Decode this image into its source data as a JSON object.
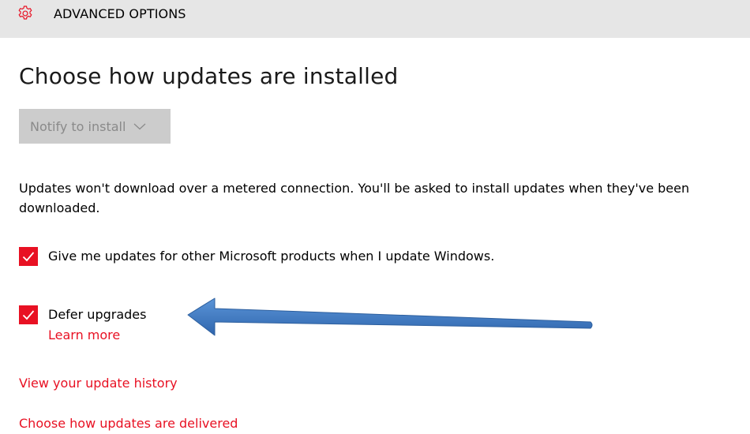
{
  "header": {
    "title": "ADVANCED OPTIONS",
    "icon": "gear-icon"
  },
  "main": {
    "heading": "Choose how updates are installed",
    "install_mode": {
      "selected": "Notify to install",
      "disabled": true
    },
    "description": "Updates won't download over a metered connection. You'll be asked to install updates when they've been downloaded.",
    "options": [
      {
        "label": "Give me updates for other Microsoft products when I update Windows.",
        "checked": true
      },
      {
        "label": "Defer upgrades",
        "checked": true,
        "link": "Learn more"
      }
    ],
    "links": {
      "history": "View your update history",
      "delivery": "Choose how updates are delivered"
    }
  },
  "colors": {
    "accent": "#e81123",
    "titlebar_bg": "#e6e6e6",
    "dropdown_bg": "#cccccc",
    "annotation_arrow": "#3c7ac7"
  }
}
